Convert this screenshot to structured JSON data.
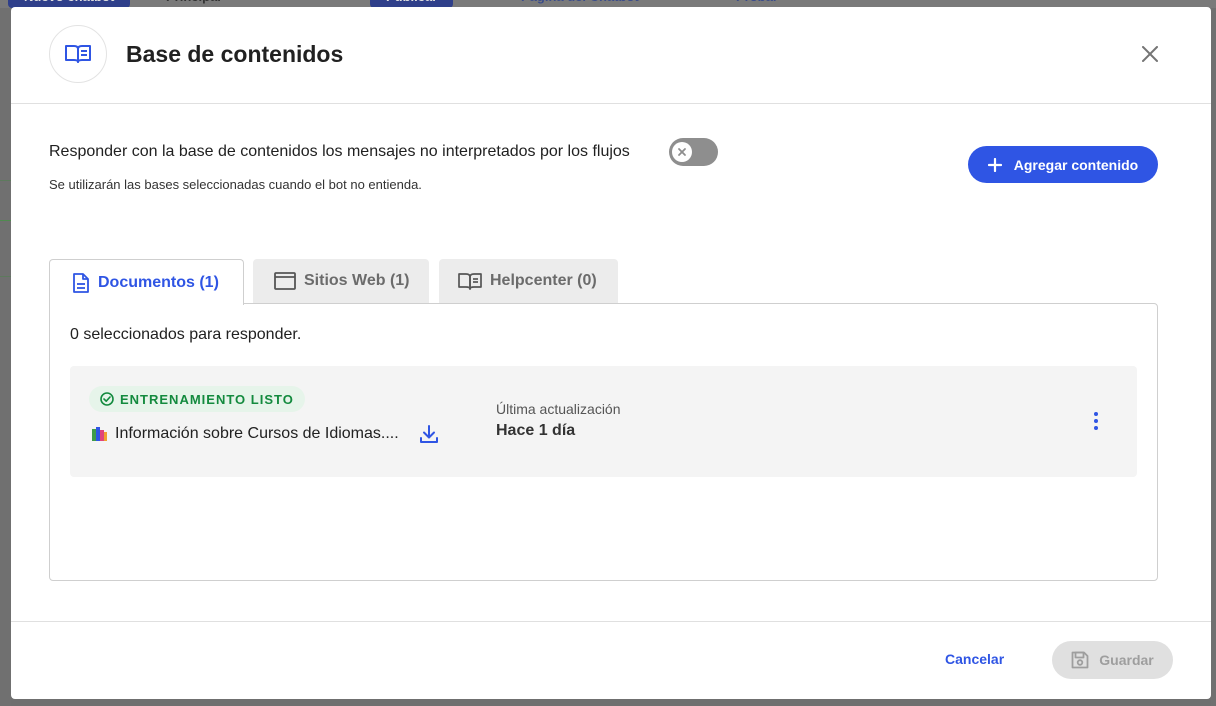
{
  "background": {
    "buttons": [
      "Nuevo chatbot",
      "Principal",
      "Publicar",
      "Página del Chatbot",
      "Probar"
    ]
  },
  "modal": {
    "title": "Base de contenidos",
    "header_icon": "book-open-icon",
    "close_icon": "close-icon"
  },
  "settings": {
    "toggle_label": "Responder con la base de contenidos los mensajes no interpretados por los flujos",
    "toggle_enabled": false,
    "hint": "Se utilizarán las bases seleccionadas cuando el bot no entienda.",
    "add_button": "Agregar contenido"
  },
  "tabs": [
    {
      "label": "Documentos (1)",
      "icon": "document-icon",
      "active": true
    },
    {
      "label": "Sitios Web (1)",
      "icon": "browser-window-icon",
      "active": false
    },
    {
      "label": "Helpcenter (0)",
      "icon": "book-open-icon",
      "active": false
    }
  ],
  "panel": {
    "selected_count": "0 seleccionados para responder.",
    "documents": [
      {
        "status": "ENTRENAMIENTO LISTO",
        "name": "Información sobre Cursos de Idiomas....",
        "updated_label": "Última actualización",
        "updated_value": "Hace 1 día"
      }
    ]
  },
  "footer": {
    "cancel": "Cancelar",
    "save": "Guardar"
  },
  "colors": {
    "accent": "#2f55e4",
    "success": "#138a3e",
    "success_bg": "#e6f4ea"
  }
}
